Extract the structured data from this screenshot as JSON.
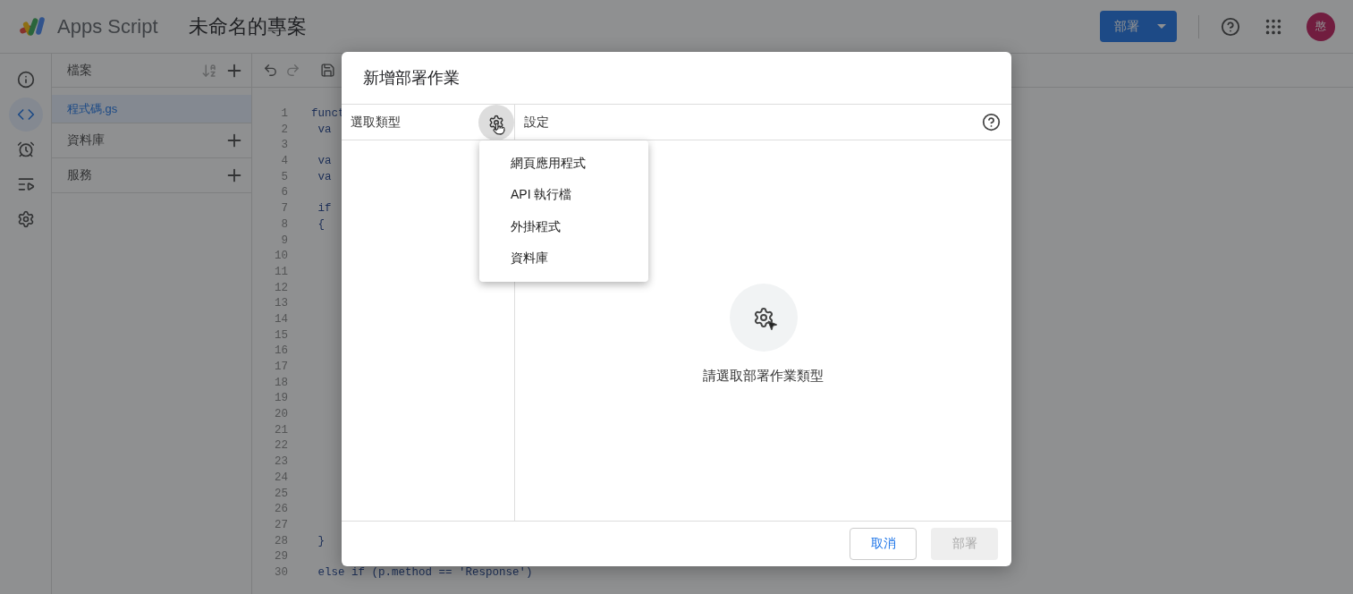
{
  "app": {
    "name": "Apps Script",
    "project_title": "未命名的專案",
    "deploy_button": "部署",
    "avatar_letter": "憨"
  },
  "rail": [
    {
      "selected": false
    },
    {
      "selected": true
    },
    {
      "selected": false
    },
    {
      "selected": false
    },
    {
      "selected": false
    }
  ],
  "files": {
    "title": "檔案",
    "items": [
      {
        "label": "程式碼.gs",
        "selected": true
      }
    ],
    "sections": [
      {
        "label": "資料庫"
      },
      {
        "label": "服務"
      }
    ]
  },
  "editor": {
    "lines": [
      {
        "n": "1",
        "code": "funct"
      },
      {
        "n": "2",
        "code": " va"
      },
      {
        "n": "3"
      },
      {
        "n": "4",
        "code": " va"
      },
      {
        "n": "5",
        "code": " va"
      },
      {
        "n": "6"
      },
      {
        "n": "7",
        "code": " if"
      },
      {
        "n": "8",
        "code": " {"
      },
      {
        "n": "9"
      },
      {
        "n": "10"
      },
      {
        "n": "11"
      },
      {
        "n": "12"
      },
      {
        "n": "13"
      },
      {
        "n": "14"
      },
      {
        "n": "15"
      },
      {
        "n": "16"
      },
      {
        "n": "17"
      },
      {
        "n": "18"
      },
      {
        "n": "19"
      },
      {
        "n": "20"
      },
      {
        "n": "21"
      },
      {
        "n": "22"
      },
      {
        "n": "23"
      },
      {
        "n": "24"
      },
      {
        "n": "25"
      },
      {
        "n": "26"
      },
      {
        "n": "27"
      },
      {
        "n": "28",
        "code": " }"
      },
      {
        "n": "29"
      },
      {
        "n": "30",
        "code": " else if (p.method == 'Response')"
      }
    ]
  },
  "dialog": {
    "title": "新增部署作業",
    "left_header": "選取類型",
    "right_header": "設定",
    "empty_message": "請選取部署作業類型",
    "cancel": "取消",
    "deploy": "部署",
    "deploy_disabled": true
  },
  "type_menu": [
    {
      "label": "網頁應用程式"
    },
    {
      "label": "API 執行檔"
    },
    {
      "label": "外掛程式"
    },
    {
      "label": "資料庫"
    }
  ]
}
